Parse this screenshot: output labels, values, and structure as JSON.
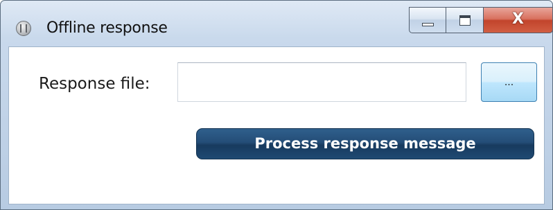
{
  "window": {
    "title": "Offline response",
    "icon": "app-icon",
    "controls": {
      "minimize": "minimize-icon",
      "maximize": "maximize-icon",
      "close_label": "X"
    }
  },
  "form": {
    "response_file_label": "Response file:",
    "response_file_value": "",
    "response_file_placeholder": "",
    "browse_label": "...",
    "process_label": "Process response message"
  },
  "colors": {
    "accent": "#1f4a73",
    "close": "#c2442c"
  }
}
